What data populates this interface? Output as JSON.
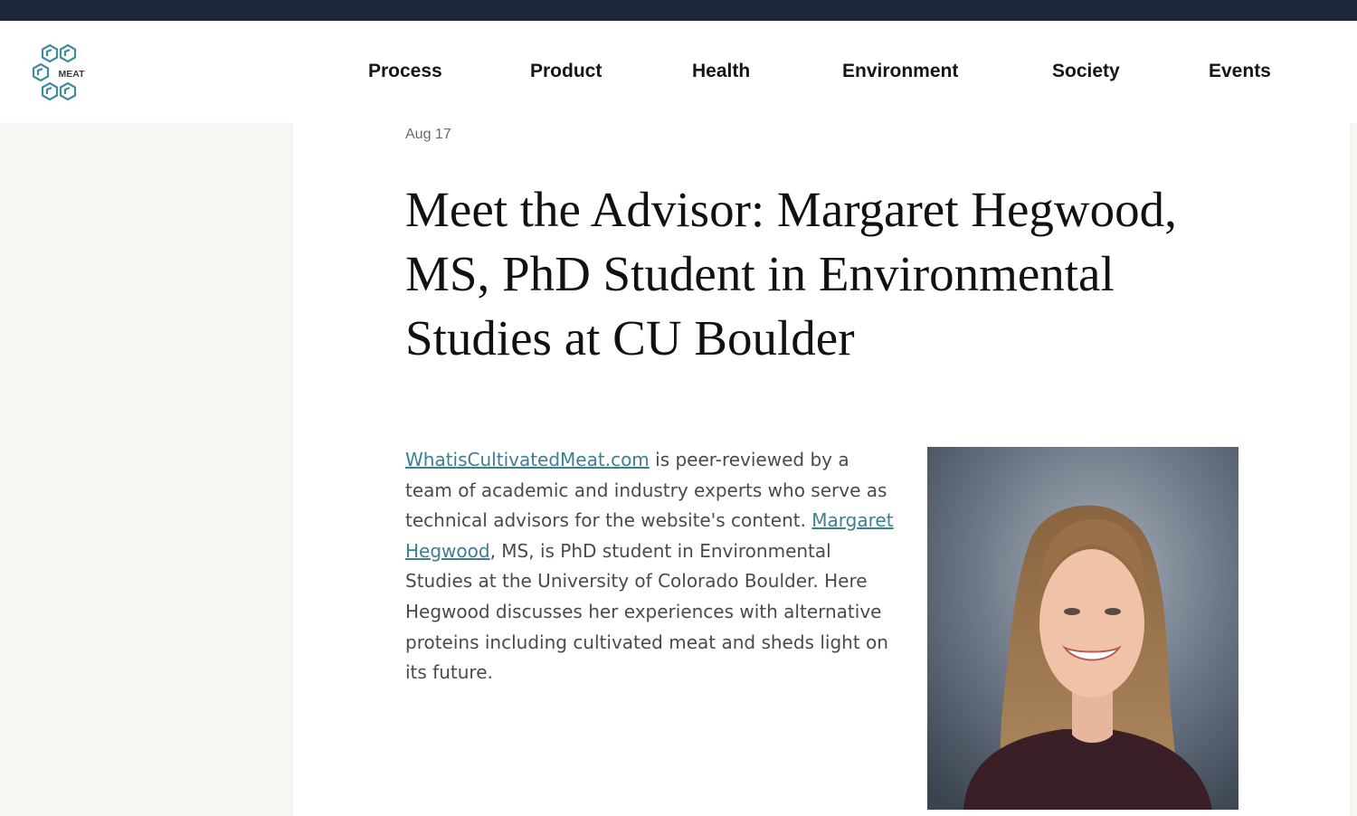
{
  "header": {
    "logo_text": "MEAT",
    "nav": [
      "Process",
      "Product",
      "Health",
      "Environment",
      "Society",
      "Events"
    ]
  },
  "article": {
    "date": "Aug 17",
    "title": "Meet the Advisor: Margaret Hegwood, MS, PhD Student in Environmental Studies at CU Boulder",
    "intro": {
      "link1": "WhatisCultivatedMeat.com",
      "text1": " is peer-reviewed by a team of academic and industry experts who serve as technical advisors for the website's content. ",
      "link2": "Margaret Hegwood",
      "text2": ", MS, is PhD student in Environmental Studies at the University of Colorado Boulder. Here Hegwood discusses her experiences with alternative proteins including cultivated meat and sheds light on its future."
    }
  },
  "colors": {
    "top_strip": "#1e2639",
    "logo_teal": "#3f8a9c",
    "link": "#3c7f93"
  }
}
